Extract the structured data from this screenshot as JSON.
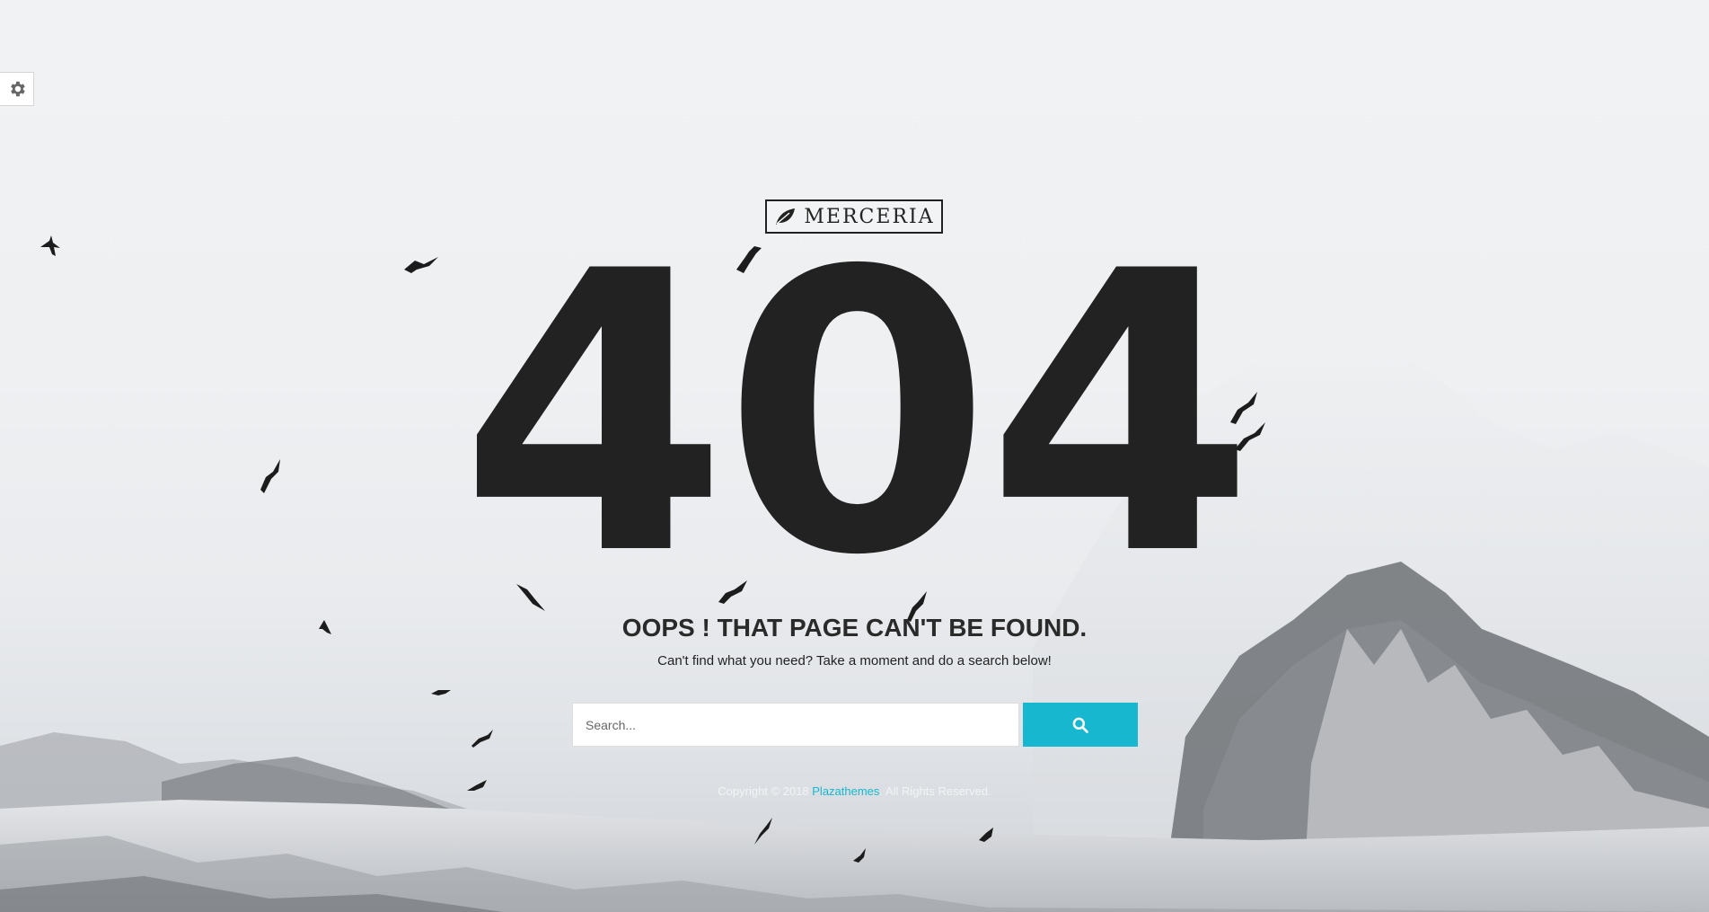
{
  "theme": {
    "accent": "#17b8cf",
    "text_dark": "#222222"
  },
  "settings": {
    "icon": "gear-icon"
  },
  "logo": {
    "text": "MERCERIA",
    "icon": "leaf-icon"
  },
  "error": {
    "code": "404",
    "headline": "OOPS ! THAT PAGE CAN'T BE FOUND.",
    "message": "Can't find what you need? Take a moment and do a search below!"
  },
  "search": {
    "placeholder": "Search...",
    "value": "",
    "button_icon": "search-icon"
  },
  "footer": {
    "prefix": "Copyright © 2018 ",
    "brand_link": "Plazathemes",
    "suffix": ". All Rights Reserved."
  }
}
